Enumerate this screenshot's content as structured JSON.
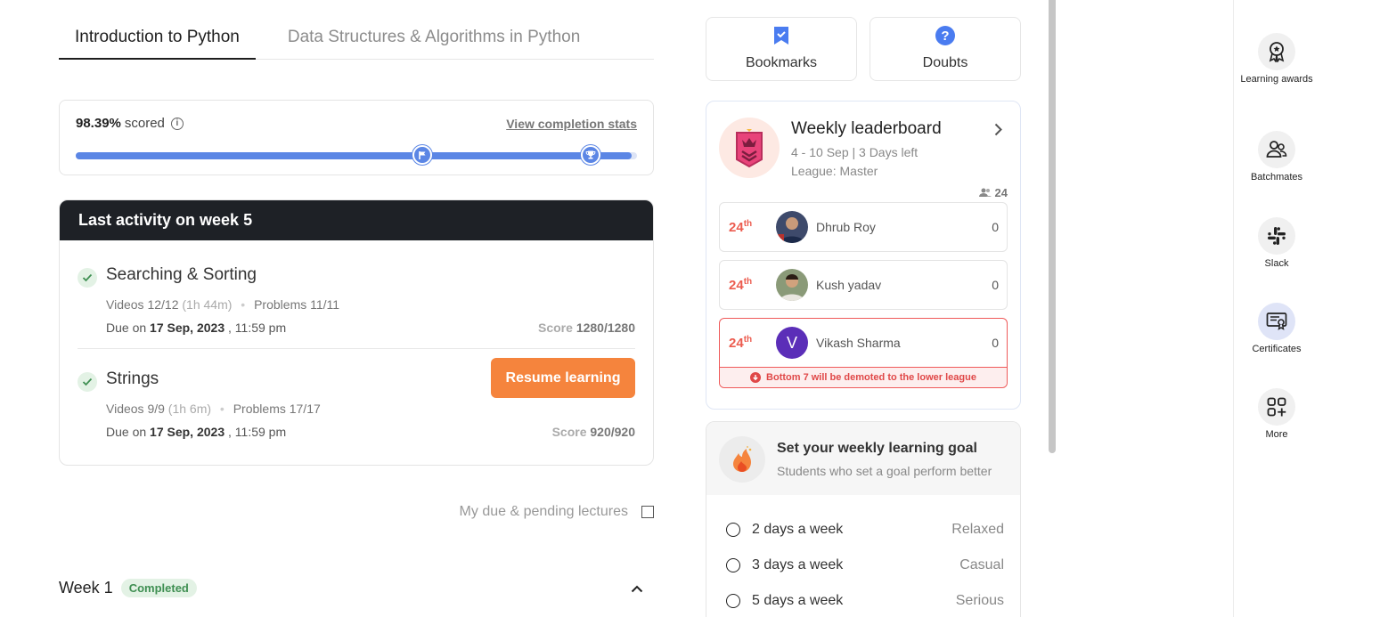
{
  "tabs": [
    {
      "label": "Introduction to Python"
    },
    {
      "label": "Data Structures & Algorithms in Python"
    }
  ],
  "score": {
    "percent": "98.39%",
    "suffix": "scored",
    "link": "View completion stats",
    "progress_fraction": 0.99
  },
  "activity": {
    "header": "Last activity on week 5",
    "modules": [
      {
        "title": "Searching & Sorting",
        "videos": "Videos 12/12",
        "video_time": "(1h 44m)",
        "problems": "Problems 11/11",
        "due_prefix": "Due on",
        "due_date": "17 Sep, 2023",
        "due_time": ", 11:59 pm",
        "score_label": "Score",
        "score_value": "1280/1280"
      },
      {
        "title": "Strings",
        "videos": "Videos 9/9",
        "video_time": "(1h 6m)",
        "problems": "Problems 17/17",
        "due_prefix": "Due on",
        "due_date": "17 Sep, 2023",
        "due_time": ", 11:59 pm",
        "score_label": "Score",
        "score_value": "920/920"
      }
    ],
    "resume_button": "Resume learning"
  },
  "pending_filter": "My due & pending lectures",
  "week": {
    "title": "Week 1",
    "status": "Completed"
  },
  "quick_actions": [
    {
      "label": "Bookmarks",
      "icon": "bookmark-icon"
    },
    {
      "label": "Doubts",
      "icon": "question-icon"
    }
  ],
  "leaderboard": {
    "title": "Weekly leaderboard",
    "subtitle": "4 - 10 Sep | 3 Days left",
    "league": "League: Master",
    "count": "24",
    "rows": [
      {
        "rank": "24",
        "rank_suffix": "th",
        "name": "Dhrub Roy",
        "score": "0"
      },
      {
        "rank": "24",
        "rank_suffix": "th",
        "name": "Kush yadav",
        "score": "0"
      },
      {
        "rank": "24",
        "rank_suffix": "th",
        "name": "Vikash Sharma",
        "score": "0",
        "initial": "V"
      }
    ],
    "demote_notice": "Bottom 7 will be demoted to the lower league"
  },
  "goal": {
    "title": "Set your weekly learning goal",
    "subtitle": "Students who set a goal perform better",
    "options": [
      {
        "days": "2 days a week",
        "mode": "Relaxed"
      },
      {
        "days": "3 days a week",
        "mode": "Casual"
      },
      {
        "days": "5 days a week",
        "mode": "Serious"
      }
    ]
  },
  "rail": [
    {
      "label": "Learning awards",
      "icon": "award-icon"
    },
    {
      "label": "Batchmates",
      "icon": "people-icon"
    },
    {
      "label": "Slack",
      "icon": "slack-icon"
    },
    {
      "label": "Certificates",
      "icon": "certificate-icon"
    },
    {
      "label": "More",
      "icon": "grid-plus-icon"
    }
  ],
  "colors": {
    "accent_blue": "#5b86e5",
    "orange": "#f5843d",
    "dark_header": "#1e2126",
    "rank_red": "#ec5c4f",
    "success_green": "#3f8f52"
  }
}
